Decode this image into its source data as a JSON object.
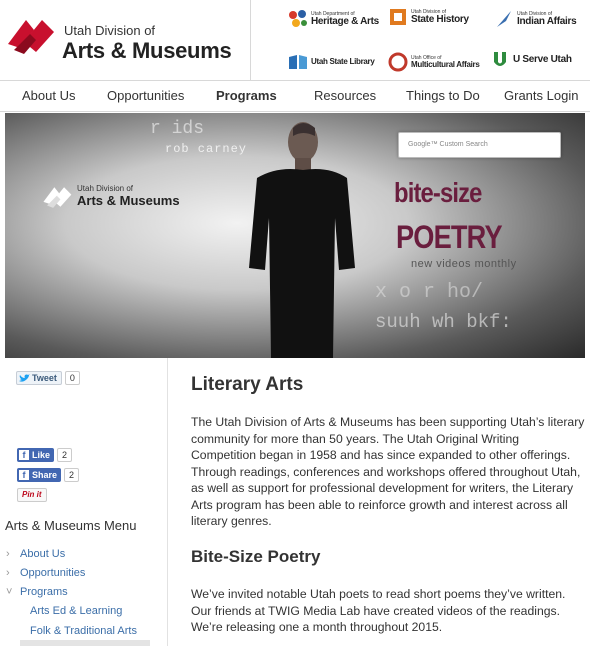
{
  "header": {
    "logo_small": "Utah Division of",
    "logo_big": "Arts & Museums",
    "partners": [
      {
        "small": "Utah Department of",
        "name": "Heritage & Arts",
        "color": "#d6392b"
      },
      {
        "small": "Utah Division of",
        "name": "State History",
        "color": "#e07a1f"
      },
      {
        "small": "Utah Division of",
        "name": "Indian Affairs",
        "color": "#3a6fb0"
      },
      {
        "small": "",
        "name": "Utah State Library",
        "color": "#2a6fb5"
      },
      {
        "small": "Utah Office of",
        "name": "Multicultural Affairs",
        "color": "#c0392b"
      },
      {
        "small": "",
        "name": "U Serve Utah",
        "color": "#2e8b3e"
      }
    ]
  },
  "nav": {
    "items": [
      "About Us",
      "Opportunities",
      "Programs",
      "Resources",
      "Things to Do",
      "Grants Login"
    ],
    "active": "Programs"
  },
  "banner": {
    "poet_name": "rob carney",
    "search_placeholder": "Google™ Custom Search",
    "logo_small": "Utah Division of",
    "logo_big": "Arts & Museums",
    "title_line1": "bite-size",
    "title_line2": "POETRY",
    "tagline": "new videos monthly",
    "title_color": "#6a1e3e"
  },
  "social": {
    "tweet_label": "Tweet",
    "tweet_count": "0",
    "like_label": "Like",
    "like_count": "2",
    "share_label": "Share",
    "share_count": "2",
    "pin_label": "Pin it"
  },
  "sidebar": {
    "menu_title": "Arts & Museums Menu",
    "items": [
      {
        "label": "About Us",
        "chevron": "›"
      },
      {
        "label": "Opportunities",
        "chevron": "›"
      },
      {
        "label": "Programs",
        "chevron": "˅"
      }
    ],
    "sub_items": [
      "Arts Ed & Learning",
      "Folk & Traditional Arts"
    ]
  },
  "main": {
    "heading": "Literary Arts",
    "intro": "The Utah Division of Arts & Museums has been supporting Utah’s literary community for more than 50 years. The Utah Original Writing Competition began in 1958 and has since expanded to other offerings. Through readings, conferences and workshops offered throughout Utah, as well as support for professional development for writers, the Literary Arts program has been able to reinforce growth and interest across all literary genres.",
    "subheading": "Bite-Size Poetry",
    "subtext": "We’ve invited notable Utah poets to read short poems they’ve written. Our friends at TWIG Media Lab have created videos of the readings. We’re releasing one a month throughout 2015."
  }
}
